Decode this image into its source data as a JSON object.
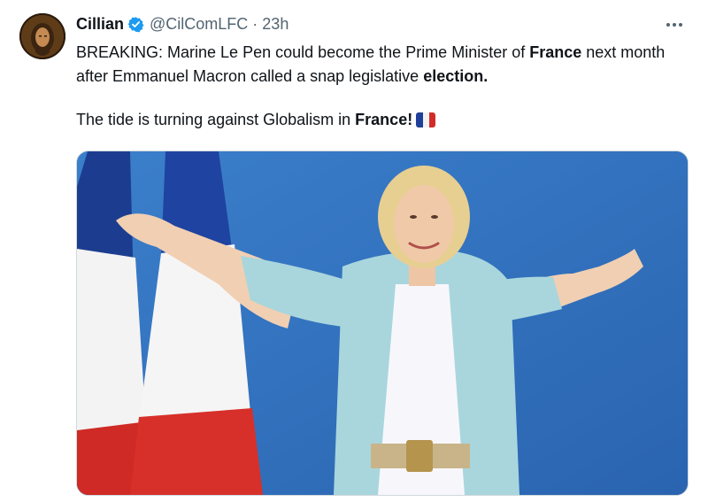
{
  "author": {
    "name": "Cillian",
    "handle": "@CilComLFC",
    "separator": "·",
    "time": "23h"
  },
  "tweet": {
    "line1_part1": "BREAKING: Marine Le Pen could become the Prime Minister of ",
    "line1_bold1": "France",
    "line1_part2": " next month after Emmanuel Macron called a snap legislative ",
    "line1_bold2": "election.",
    "line2_part1": "The tide is turning against Globalism in ",
    "line2_bold": "France!",
    "flag_emoji_name": "france-flag-icon"
  },
  "colors": {
    "verified_badge": "#1d9bf0",
    "text_primary": "#0f1419",
    "text_secondary": "#536471",
    "flag_blue": "#1f3f9a",
    "flag_white": "#f2f2f2",
    "flag_red": "#d42a2a"
  },
  "icons": {
    "verified": "verified-badge-icon",
    "more": "more-options-icon"
  }
}
